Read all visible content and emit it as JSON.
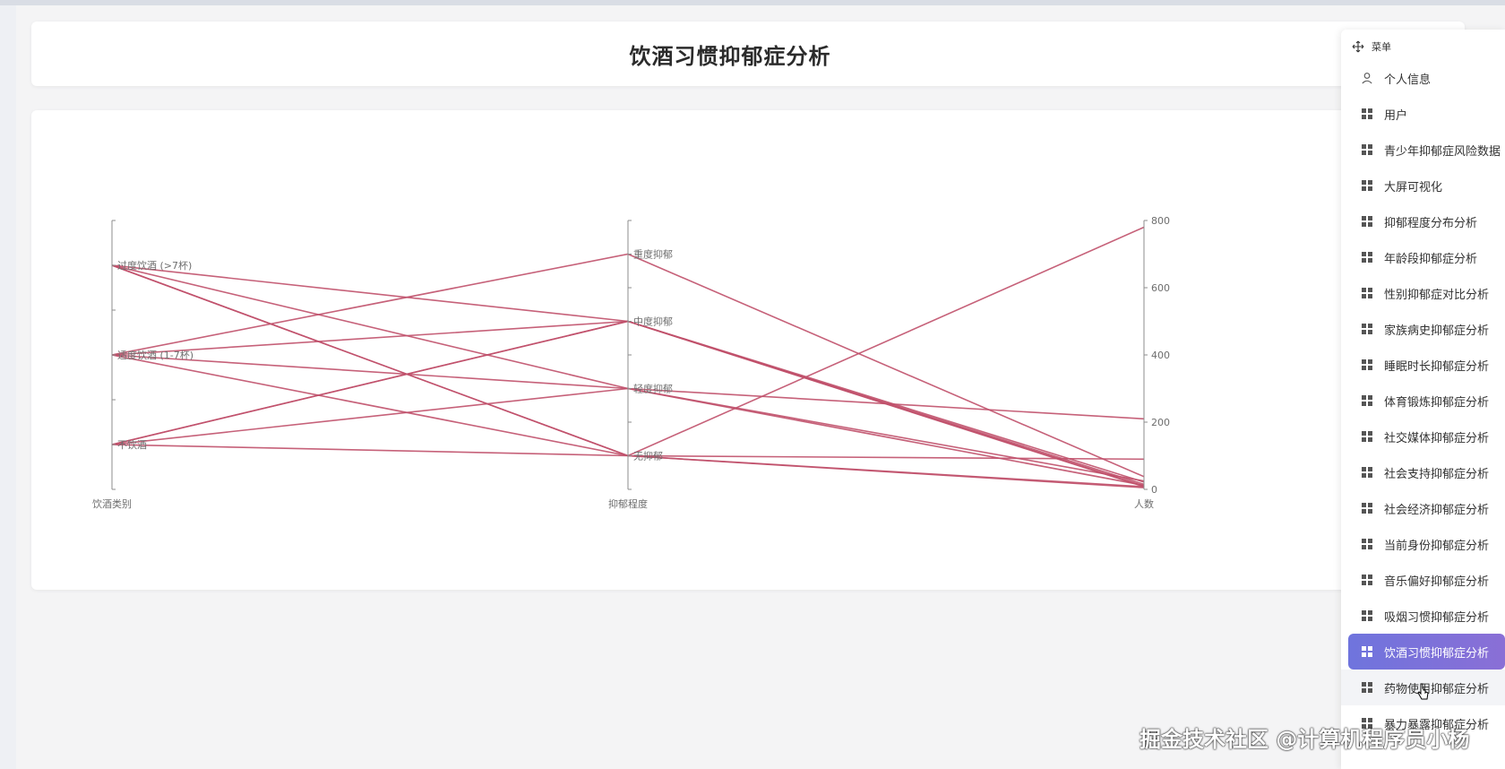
{
  "page": {
    "title": "饮酒习惯抑郁症分析"
  },
  "menu": {
    "header": "菜单",
    "items": [
      {
        "label": "个人信息",
        "icon": "user-icon"
      },
      {
        "label": "用户",
        "icon": "grid-icon"
      },
      {
        "label": "青少年抑郁症风险数据",
        "icon": "grid-icon"
      },
      {
        "label": "大屏可视化",
        "icon": "grid-icon"
      },
      {
        "label": "抑郁程度分布分析",
        "icon": "grid-icon"
      },
      {
        "label": "年龄段抑郁症分析",
        "icon": "grid-icon"
      },
      {
        "label": "性别抑郁症对比分析",
        "icon": "grid-icon"
      },
      {
        "label": "家族病史抑郁症分析",
        "icon": "grid-icon"
      },
      {
        "label": "睡眠时长抑郁症分析",
        "icon": "grid-icon"
      },
      {
        "label": "体育锻炼抑郁症分析",
        "icon": "grid-icon"
      },
      {
        "label": "社交媒体抑郁症分析",
        "icon": "grid-icon"
      },
      {
        "label": "社会支持抑郁症分析",
        "icon": "grid-icon"
      },
      {
        "label": "社会经济抑郁症分析",
        "icon": "grid-icon"
      },
      {
        "label": "当前身份抑郁症分析",
        "icon": "grid-icon"
      },
      {
        "label": "音乐偏好抑郁症分析",
        "icon": "grid-icon"
      },
      {
        "label": "吸烟习惯抑郁症分析",
        "icon": "grid-icon"
      },
      {
        "label": "饮酒习惯抑郁症分析",
        "icon": "grid-icon",
        "active": true
      },
      {
        "label": "药物使用抑郁症分析",
        "icon": "grid-icon",
        "hover": true
      },
      {
        "label": "暴力暴露抑郁症分析",
        "icon": "grid-icon"
      }
    ]
  },
  "watermark": "掘金技术社区 @计算机程序员小杨",
  "colors": {
    "series": "#c0506a",
    "active_start": "#6f74dd",
    "active_end": "#8a6fd6"
  },
  "chart_data": {
    "type": "parallel",
    "axes": [
      {
        "name": "饮酒类别",
        "type": "category",
        "categories": [
          "不饮酒",
          "适度饮酒 (1-7杯)",
          "过度饮酒 (>7杯)"
        ]
      },
      {
        "name": "抑郁程度",
        "type": "category",
        "categories": [
          "无抑郁",
          "轻度抑郁",
          "中度抑郁",
          "重度抑郁"
        ]
      },
      {
        "name": "人数",
        "type": "value",
        "min": 0,
        "max": 800,
        "ticks": [
          0,
          200,
          400,
          600,
          800
        ]
      }
    ],
    "rows": [
      [
        "过度饮酒 (>7杯)",
        "中度抑郁",
        10
      ],
      [
        "过度饮酒 (>7杯)",
        "轻度抑郁",
        25
      ],
      [
        "过度饮酒 (>7杯)",
        "无抑郁",
        8
      ],
      [
        "过度饮酒 (>7杯)",
        "无抑郁",
        5
      ],
      [
        "适度饮酒 (1-7杯)",
        "重度抑郁",
        38
      ],
      [
        "适度饮酒 (1-7杯)",
        "中度抑郁",
        15
      ],
      [
        "适度饮酒 (1-7杯)",
        "轻度抑郁",
        210
      ],
      [
        "适度饮酒 (1-7杯)",
        "无抑郁",
        90
      ],
      [
        "不饮酒",
        "中度抑郁",
        22
      ],
      [
        "不饮酒",
        "中度抑郁",
        8
      ],
      [
        "不饮酒",
        "轻度抑郁",
        12
      ],
      [
        "不饮酒",
        "无抑郁",
        780
      ]
    ]
  }
}
